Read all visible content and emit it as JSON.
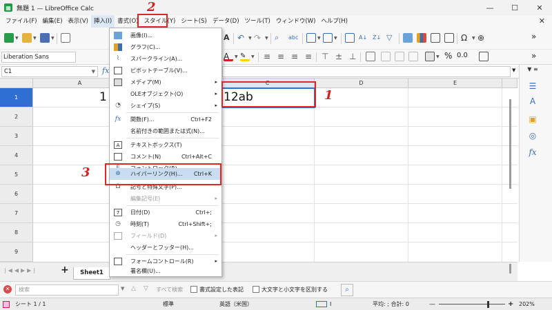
{
  "window": {
    "title": "無題 1 — LibreOffice Calc",
    "controls": {
      "minimize": "—",
      "maximize": "☐",
      "close": "✕"
    }
  },
  "menubar": {
    "items": [
      {
        "label": "ファイル(F)"
      },
      {
        "label": "編集(E)"
      },
      {
        "label": "表示(V)"
      },
      {
        "label": "挿入(I)"
      },
      {
        "label": "書式(O)"
      },
      {
        "label": "スタイル(Y)"
      },
      {
        "label": "シート(S)"
      },
      {
        "label": "データ(D)"
      },
      {
        "label": "ツール(T)"
      },
      {
        "label": "ウィンドウ(W)"
      },
      {
        "label": "ヘルプ(H)"
      }
    ],
    "close_glyph": "✕"
  },
  "toolbar": {
    "font_name": "Liberation Sans",
    "percent_label": "%",
    "decimal_label": "0.0",
    "overflow_glyph": "»"
  },
  "formula_bar": {
    "cell_ref": "C1",
    "fx_label": "fx"
  },
  "sheet": {
    "columns": [
      "A",
      "B",
      "C",
      "D",
      "E"
    ],
    "rows": [
      "1",
      "2",
      "3",
      "4",
      "5",
      "6",
      "7",
      "8",
      "9"
    ],
    "cells": {
      "A1": "1",
      "C1": "12ab"
    }
  },
  "insert_menu": {
    "items": [
      {
        "label": "画像(I)...",
        "icon": "image-icon"
      },
      {
        "label": "グラフ(C)...",
        "icon": "chart-icon"
      },
      {
        "label": "スパークライン(A)...",
        "icon": "sparkline-icon"
      },
      {
        "label": "ピボットテーブル(V)...",
        "icon": "pivot-icon"
      },
      {
        "label": "メディア(M)",
        "icon": "media-icon",
        "arrow": "▸"
      },
      {
        "label": "OLEオブジェクト(O)",
        "arrow": "▸"
      },
      {
        "label": "シェイプ(S)",
        "icon": "shape-icon",
        "arrow": "▸"
      },
      {
        "label": "関数(F)...",
        "icon": "function-icon",
        "shortcut": "Ctrl+F2"
      },
      {
        "label": "名前付きの範囲または式(N)..."
      },
      {
        "label": "テキストボックス(T)",
        "icon": "textbox-icon"
      },
      {
        "label": "コメント(N)",
        "icon": "comment-icon",
        "shortcut": "Ctrl+Alt+C"
      },
      {
        "label": "フォントワーク(R)...",
        "icon": "fontwork-icon"
      },
      {
        "label": "ハイパーリンク(H)...",
        "icon": "hyperlink-icon",
        "shortcut": "Ctrl+K",
        "highlight": true
      },
      {
        "label": "記号と特殊文字(P)...",
        "icon": "symbol-icon"
      },
      {
        "label": "編集記号(E)",
        "disabled": true,
        "arrow": "▸"
      },
      {
        "label": "日付(D)",
        "icon": "date-icon",
        "shortcut": "Ctrl+;"
      },
      {
        "label": "時刻(T)",
        "icon": "time-icon",
        "shortcut": "Ctrl+Shift+;"
      },
      {
        "label": "フィールド(D)",
        "icon": "field-icon",
        "disabled": true,
        "arrow": "▸"
      },
      {
        "label": "ヘッダーとフッター(H)..."
      },
      {
        "label": "フォームコントロール(R)",
        "icon": "form-control-icon",
        "arrow": "▸"
      },
      {
        "label": "署名欄(U)..."
      }
    ]
  },
  "tabs": {
    "sheet_tab": "Sheet1",
    "add_glyph": "+"
  },
  "find_bar": {
    "placeholder": "検索",
    "find_all_label": "すべて検索",
    "formatted_label": "書式設定した表記",
    "match_case_label": "大文字と小文字を区別する"
  },
  "statusbar": {
    "sheet_info": "シート 1 / 1",
    "page_style": "標準",
    "language": "英語（米国）",
    "summary": "平均: ; 合計: 0",
    "zoom": "202%",
    "zoom_minus": "—",
    "zoom_plus": "+"
  },
  "annotations": {
    "step1": "1",
    "step2": "2",
    "step3": "3",
    "color": "#e02525"
  }
}
